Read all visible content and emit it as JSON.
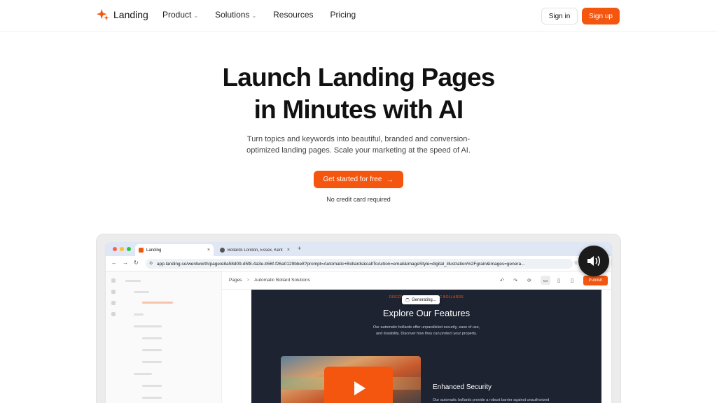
{
  "nav": {
    "brand": "Landing",
    "menu": [
      {
        "label": "Product",
        "has_dropdown": true
      },
      {
        "label": "Solutions",
        "has_dropdown": true
      },
      {
        "label": "Resources",
        "has_dropdown": false
      },
      {
        "label": "Pricing",
        "has_dropdown": false
      }
    ],
    "signin": "Sign in",
    "signup": "Sign up"
  },
  "hero": {
    "title_line1": "Launch Landing Pages",
    "title_line2": "in Minutes with AI",
    "subtitle_line1": "Turn topics and keywords into beautiful, branded and conversion-",
    "subtitle_line2": "optimized landing pages. Scale your marketing at the speed of AI.",
    "cta": "Get started for free",
    "cta_arrow": "→",
    "note": "No credit card required"
  },
  "mockup": {
    "tabs": [
      {
        "label": "Landing",
        "active": true
      },
      {
        "label": "Bollards London, Essex, Kent",
        "active": false
      }
    ],
    "tab_close": "×",
    "tab_new": "+",
    "url": "app.landing.so/wentworth/page/e8a58d09-d5f8-4a3e-b56f-f26a0129bbe8?prompt=Automatic+Bollards&callToAction=email&imageStyle=digital_illustration%2Fgrain&images=genera...",
    "breadcrumb": {
      "root": "Pages",
      "separator": ">",
      "current": "Automatic Bollard Solutions"
    },
    "publish": "Publish",
    "canvas": {
      "eyebrow": "DISCOVER OUR AUTOMATIC BOLLARDS",
      "generating": "Generating...",
      "features_title": "Explore Our Features",
      "features_desc_line1": "Our automatic bollards offer unparalleled security, ease of use,",
      "features_desc_line2": "and durability. Discover how they can protect your property.",
      "enhanced_title": "Enhanced Security",
      "enhanced_desc": "Our automatic bollards provide a robust barrier against unauthorized"
    }
  },
  "colors": {
    "accent": "#f4560f",
    "canvas_bg": "#1d2331",
    "tabstrip": "#dfe6f4"
  },
  "icons": [
    "sparkle-logo-icon",
    "chevron-down-icon",
    "arrow-right-icon",
    "back-icon",
    "forward-icon",
    "reload-icon",
    "site-settings-icon",
    "star-icon",
    "undo-icon",
    "redo-icon",
    "desktop-icon",
    "tablet-icon",
    "mobile-icon",
    "play-icon",
    "speaker-icon"
  ]
}
